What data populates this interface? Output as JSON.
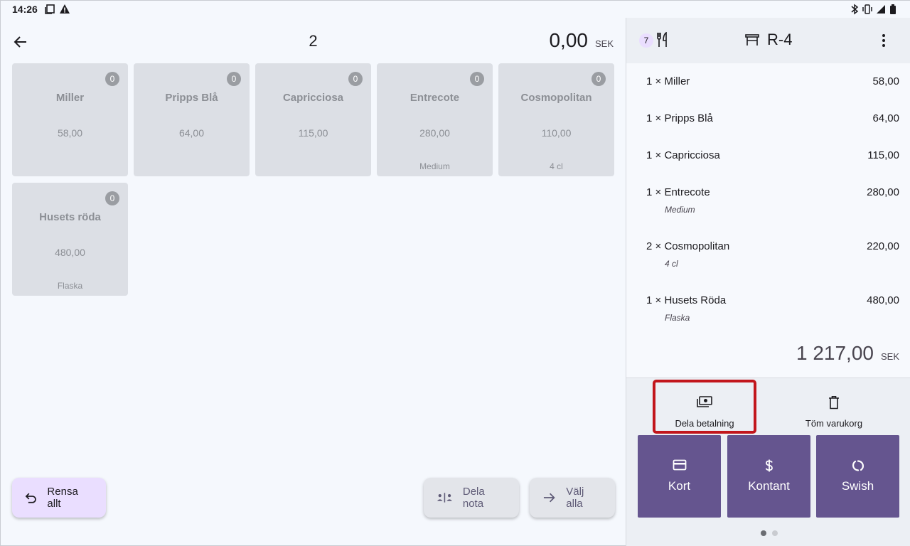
{
  "status_bar": {
    "time": "14:26"
  },
  "left": {
    "title": "2",
    "amount": "0,00",
    "currency": "SEK",
    "tiles": [
      {
        "name": "Miller",
        "price": "58,00",
        "note": "",
        "count": "0"
      },
      {
        "name": "Pripps Blå",
        "price": "64,00",
        "note": "",
        "count": "0"
      },
      {
        "name": "Capricciosa",
        "price": "115,00",
        "note": "",
        "count": "0"
      },
      {
        "name": "Entrecote",
        "price": "280,00",
        "note": "Medium",
        "count": "0"
      },
      {
        "name": "Cosmopolitan",
        "price": "110,00",
        "note": "4 cl",
        "count": "0"
      },
      {
        "name": "Husets röda",
        "price": "480,00",
        "note": "Flaska",
        "count": "0"
      }
    ],
    "buttons": {
      "rensa": "Rensa allt",
      "dela_nota": "Dela nota",
      "valj_alla": "Välj alla"
    }
  },
  "right": {
    "guest_count": "7",
    "table_label": "R-4",
    "items": [
      {
        "qty": "1 ×",
        "name": "Miller",
        "price": "58,00",
        "note": ""
      },
      {
        "qty": "1 ×",
        "name": "Pripps Blå",
        "price": "64,00",
        "note": ""
      },
      {
        "qty": "1 ×",
        "name": "Capricciosa",
        "price": "115,00",
        "note": ""
      },
      {
        "qty": "1 ×",
        "name": "Entrecote",
        "price": "280,00",
        "note": "Medium"
      },
      {
        "qty": "2 ×",
        "name": "Cosmopolitan",
        "price": "220,00",
        "note": "4 cl"
      },
      {
        "qty": "1 ×",
        "name": "Husets Röda",
        "price": "480,00",
        "note": "Flaska"
      }
    ],
    "total": "1 217,00",
    "currency": "SEK",
    "actions": {
      "split_payment": "Dela betalning",
      "empty_cart": "Töm varukorg"
    },
    "pay": {
      "card": "Kort",
      "cash": "Kontant",
      "swish": "Swish"
    }
  },
  "colors": {
    "accent": "#65558f",
    "highlight": "#c2161c",
    "tile": "#dcdfe5",
    "pill_primary": "#eadeff"
  }
}
